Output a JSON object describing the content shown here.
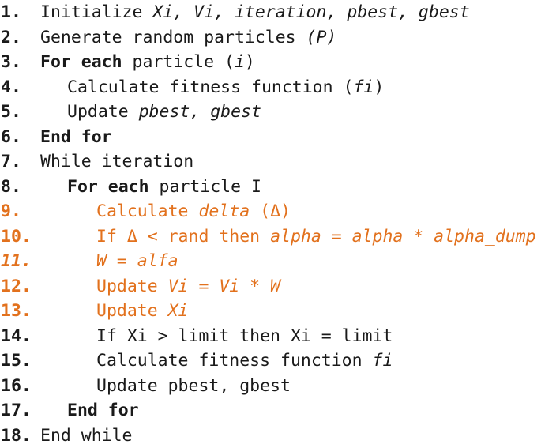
{
  "document": {
    "kind": "algorithm-pseudocode",
    "title": "",
    "colors": {
      "text": "#1a1a1a",
      "highlight": "#E2711D",
      "background": "#ffffff"
    }
  },
  "lines": [
    {
      "number": "1.",
      "number_color": "black",
      "number_italic": false,
      "indent": 0,
      "color": "black",
      "text": "Initialize Xi, Vi, iteration, pbest, gbest",
      "segments": [
        {
          "t": "Initialize ",
          "style": "plain"
        },
        {
          "t": "Xi, Vi, iteration, pbest, gbest",
          "style": "italic"
        }
      ]
    },
    {
      "number": "2.",
      "number_color": "black",
      "number_italic": false,
      "indent": 0,
      "color": "black",
      "text": "Generate random particles (P)",
      "segments": [
        {
          "t": "Generate random particles ",
          "style": "plain"
        },
        {
          "t": "(P)",
          "style": "italic"
        }
      ]
    },
    {
      "number": "3.",
      "number_color": "black",
      "number_italic": false,
      "indent": 0,
      "color": "black",
      "text": "For each particle (i)",
      "segments": [
        {
          "t": "For each",
          "style": "bold"
        },
        {
          "t": " particle (",
          "style": "plain"
        },
        {
          "t": "i",
          "style": "italic"
        },
        {
          "t": ")",
          "style": "plain"
        }
      ]
    },
    {
      "number": "4.",
      "number_color": "black",
      "number_italic": false,
      "indent": 1,
      "color": "black",
      "text": "Calculate fitness function (fi)",
      "segments": [
        {
          "t": "Calculate fitness function (",
          "style": "plain"
        },
        {
          "t": "fi",
          "style": "italic"
        },
        {
          "t": ")",
          "style": "plain"
        }
      ]
    },
    {
      "number": "5.",
      "number_color": "black",
      "number_italic": false,
      "indent": 1,
      "color": "black",
      "text": "Update pbest, gbest",
      "segments": [
        {
          "t": "Update ",
          "style": "plain"
        },
        {
          "t": "pbest, gbest",
          "style": "italic"
        }
      ]
    },
    {
      "number": "6.",
      "number_color": "black",
      "number_italic": false,
      "indent": 0,
      "color": "black",
      "text": "End for",
      "segments": [
        {
          "t": "End for",
          "style": "bold"
        }
      ]
    },
    {
      "number": "7.",
      "number_color": "black",
      "number_italic": false,
      "indent": 0,
      "color": "black",
      "text": "While iteration",
      "segments": [
        {
          "t": "While iteration",
          "style": "plain"
        }
      ]
    },
    {
      "number": "8.",
      "number_color": "black",
      "number_italic": false,
      "indent": 1,
      "color": "black",
      "text": "For each particle I",
      "segments": [
        {
          "t": "For each",
          "style": "bold"
        },
        {
          "t": " particle I",
          "style": "plain"
        }
      ]
    },
    {
      "number": "9.",
      "number_color": "orange",
      "number_italic": false,
      "indent": 2,
      "color": "orange",
      "text": "Calculate delta (Δ)",
      "segments": [
        {
          "t": "Calculate ",
          "style": "plain"
        },
        {
          "t": "delta",
          "style": "italic"
        },
        {
          "t": " (Δ)",
          "style": "plain"
        }
      ]
    },
    {
      "number": "10.",
      "number_color": "orange",
      "number_italic": false,
      "indent": 2,
      "color": "orange",
      "text": "If Δ < rand then alpha = alpha * alpha_dump",
      "segments": [
        {
          "t": "If Δ < rand then ",
          "style": "plain"
        },
        {
          "t": "alpha = alpha * alpha_dump",
          "style": "italic"
        }
      ]
    },
    {
      "number": "11.",
      "number_color": "orange",
      "number_italic": true,
      "indent": 2,
      "color": "orange",
      "text": "W = alfa",
      "segments": [
        {
          "t": "W = alfa",
          "style": "italic"
        }
      ]
    },
    {
      "number": "12.",
      "number_color": "orange",
      "number_italic": false,
      "indent": 2,
      "color": "orange",
      "text": "Update Vi = Vi * W",
      "segments": [
        {
          "t": "Update ",
          "style": "plain"
        },
        {
          "t": "Vi = Vi * W",
          "style": "italic"
        }
      ]
    },
    {
      "number": "13.",
      "number_color": "orange",
      "number_italic": false,
      "indent": 2,
      "color": "orange",
      "text": "Update Xi",
      "segments": [
        {
          "t": "Update ",
          "style": "plain"
        },
        {
          "t": "Xi",
          "style": "italic"
        }
      ]
    },
    {
      "number": "14.",
      "number_color": "black",
      "number_italic": false,
      "indent": 2,
      "color": "black",
      "text": "If Xi > limit then Xi = limit",
      "segments": [
        {
          "t": "If Xi > limit then Xi = limit",
          "style": "plain"
        }
      ]
    },
    {
      "number": "15.",
      "number_color": "black",
      "number_italic": false,
      "indent": 2,
      "color": "black",
      "text": "Calculate fitness function fi",
      "segments": [
        {
          "t": "Calculate fitness function ",
          "style": "plain"
        },
        {
          "t": "fi",
          "style": "italic"
        }
      ]
    },
    {
      "number": "16.",
      "number_color": "black",
      "number_italic": false,
      "indent": 2,
      "color": "black",
      "text": "Update pbest, gbest",
      "segments": [
        {
          "t": "Update pbest, gbest",
          "style": "plain"
        }
      ]
    },
    {
      "number": "17.",
      "number_color": "black",
      "number_italic": false,
      "indent": 1,
      "color": "black",
      "text": "End for",
      "segments": [
        {
          "t": "End for",
          "style": "bold"
        }
      ]
    },
    {
      "number": "18.",
      "number_color": "black",
      "number_italic": false,
      "indent": 0,
      "color": "black",
      "text": "End while",
      "segments": [
        {
          "t": "End while",
          "style": "plain"
        }
      ]
    }
  ]
}
